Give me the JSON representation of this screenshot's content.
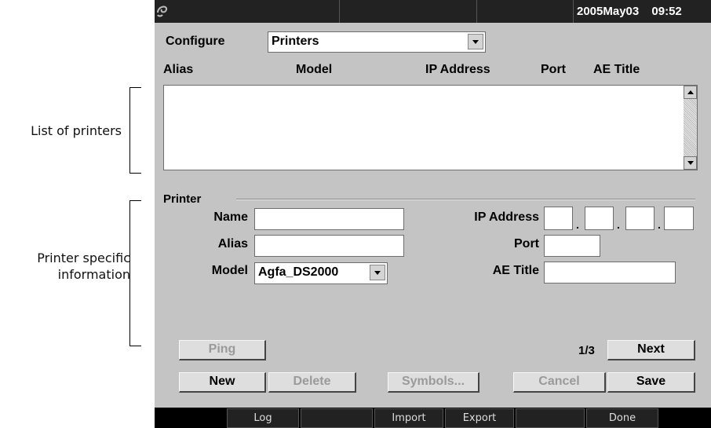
{
  "annotations": {
    "list_label": "List of printers",
    "info_label_line1": "Printer specific",
    "info_label_line2": "information"
  },
  "header": {
    "date": "2005May03",
    "time": "09:52",
    "logo_icon": "swirl-logo-icon"
  },
  "configure": {
    "label": "Configure",
    "selected": "Printers"
  },
  "table": {
    "columns": [
      "Alias",
      "Model",
      "IP Address",
      "Port",
      "AE Title"
    ],
    "rows": []
  },
  "printer": {
    "section_label": "Printer",
    "name_label": "Name",
    "name_value": "",
    "alias_label": "Alias",
    "alias_value": "",
    "model_label": "Model",
    "model_value": "Agfa_DS2000",
    "ip_label": "IP Address",
    "ip_octets": [
      "",
      "",
      "",
      ""
    ],
    "ip_separator": ".",
    "port_label": "Port",
    "port_value": "",
    "ae_title_label": "AE Title",
    "ae_title_value": ""
  },
  "buttons": {
    "ping": "Ping",
    "page": "1/3",
    "next": "Next",
    "new": "New",
    "delete": "Delete",
    "symbols": "Symbols...",
    "cancel": "Cancel",
    "save": "Save"
  },
  "bottom_tabs": [
    "Log",
    "",
    "Import",
    "Export",
    "",
    "Done"
  ]
}
